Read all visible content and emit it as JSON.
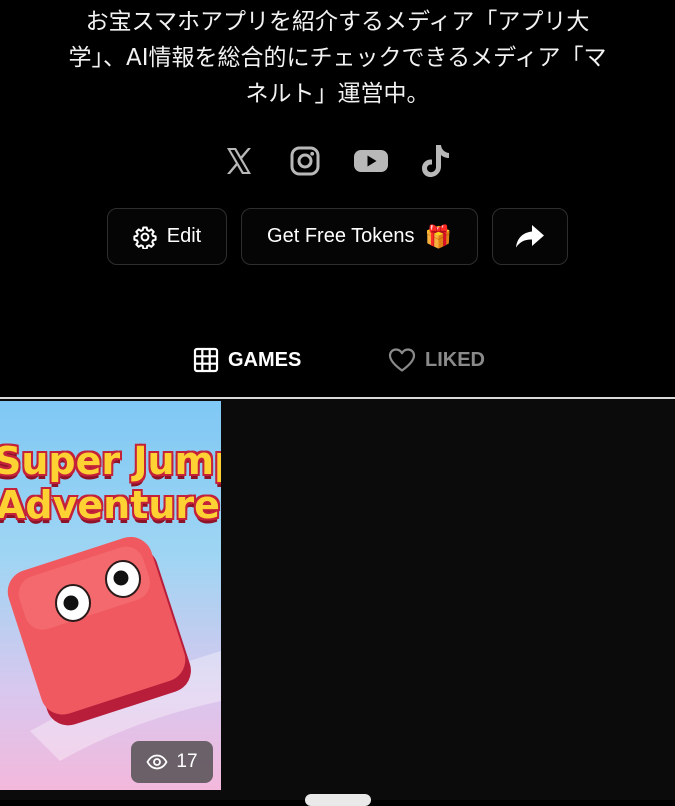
{
  "profile": {
    "bio_lines": [
      "お宝スマホアプリを紹介するメディア「アプリ大",
      "学」、AI情報を総合的にチェックできるメディア「マ",
      "ネルト」運営中。"
    ],
    "socials": [
      {
        "icon": "x-icon"
      },
      {
        "icon": "instagram-icon"
      },
      {
        "icon": "youtube-icon"
      },
      {
        "icon": "tiktok-icon"
      }
    ]
  },
  "actions": {
    "edit_label": "Edit",
    "tokens_label": "Get Free Tokens",
    "tokens_emoji": "🎁",
    "share_icon": "share-arrow-icon"
  },
  "tabs": {
    "games_label": "GAMES",
    "liked_label": "LIKED",
    "active": "GAMES"
  },
  "games": [
    {
      "title_line1": "Super Jump",
      "title_line2": "Adventure",
      "views": "17"
    }
  ],
  "colors": {
    "background": "#000000",
    "icon_gray": "#b8b8b8",
    "inactive_tab": "#8a8a8a",
    "title_yellow": "#ffd233",
    "block_red": "#f0595f"
  }
}
